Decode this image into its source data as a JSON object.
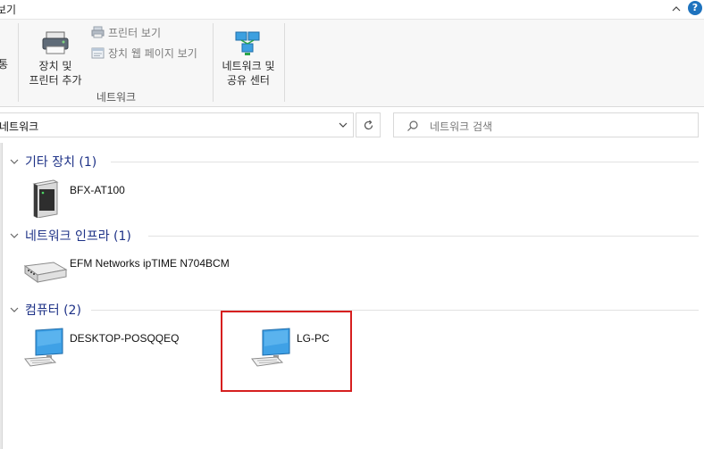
{
  "tabstrip": {
    "label": "보기",
    "help": "?"
  },
  "ribbon": {
    "left_fragment": "통",
    "add_devices": {
      "line1": "장치 및",
      "line2": "프린터 추가"
    },
    "view_printers": "프린터 보기",
    "view_device_webpage": "장치 웹 페이지 보기",
    "group_label": "네트워크",
    "network_center": {
      "line1": "네트워크 및",
      "line2": "공유 센터"
    }
  },
  "address": {
    "path": "네트워크"
  },
  "search": {
    "placeholder": "네트워크 검색"
  },
  "groups": [
    {
      "title": "기타 장치 (1)",
      "items": [
        {
          "label": "BFX-AT100",
          "icon": "server-icon"
        }
      ]
    },
    {
      "title": "네트워크 인프라 (1)",
      "items": [
        {
          "label": "EFM Networks ipTIME N704BCM",
          "icon": "router-icon"
        }
      ]
    },
    {
      "title": "컴퓨터 (2)",
      "items": [
        {
          "label": "DESKTOP-POSQQEQ",
          "icon": "computer-icon"
        },
        {
          "label": "LG-PC",
          "icon": "computer-icon"
        }
      ]
    }
  ],
  "colors": {
    "group_title": "#1e3287",
    "highlight": "#d61f1f",
    "ribbon_bg": "#f7f7f7"
  }
}
